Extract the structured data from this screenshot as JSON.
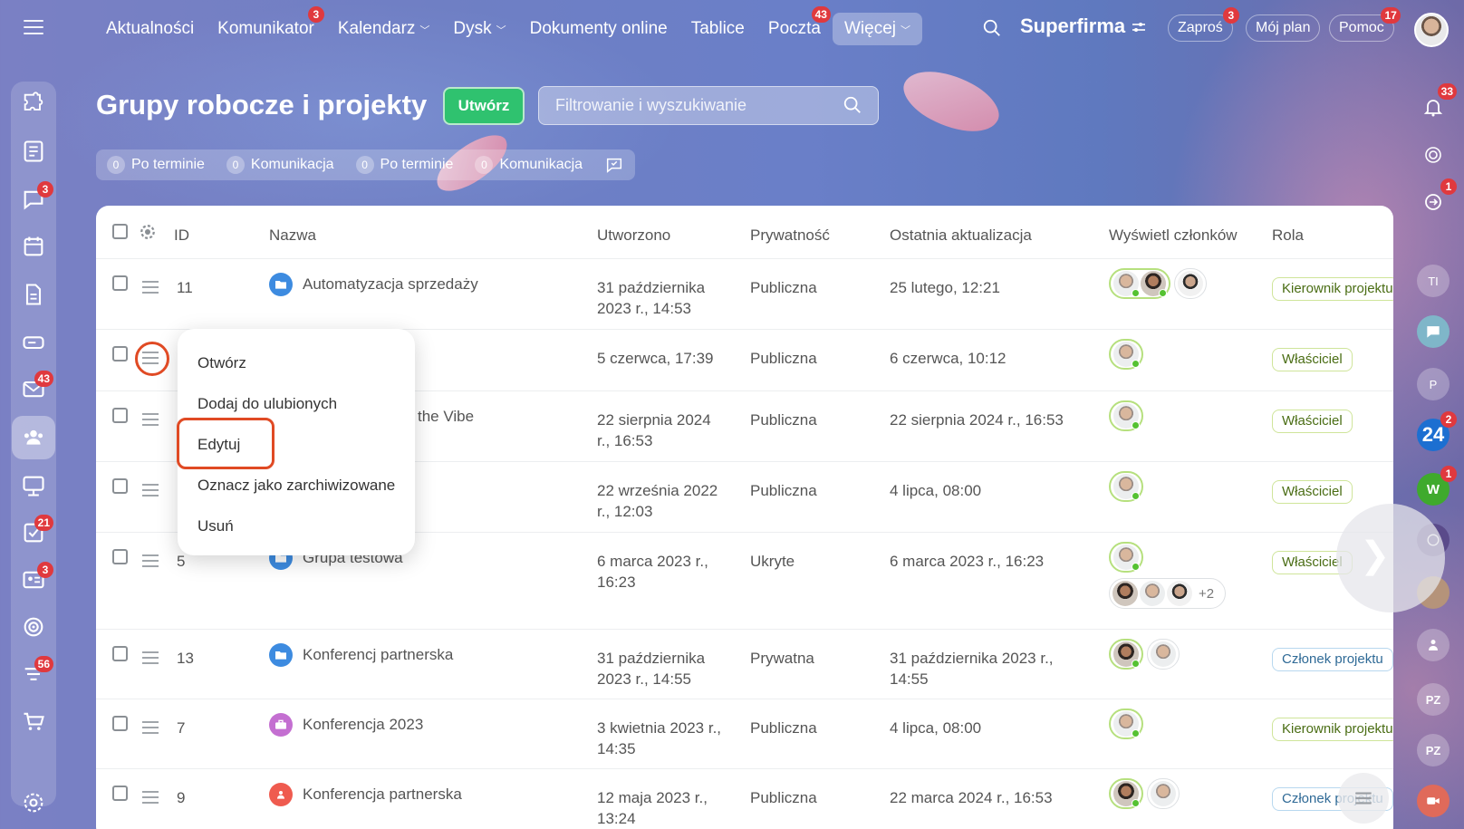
{
  "topnav": {
    "items": [
      {
        "label": "Aktualności"
      },
      {
        "label": "Komunikator",
        "badge": "3"
      },
      {
        "label": "Kalendarz",
        "chevron": true
      },
      {
        "label": "Dysk",
        "chevron": true
      },
      {
        "label": "Dokumenty online"
      },
      {
        "label": "Tablice"
      },
      {
        "label": "Poczta",
        "badge": "43"
      },
      {
        "label": "Więcej",
        "chevron": true,
        "active": true
      }
    ],
    "company": "Superfirma",
    "invite": {
      "label": "Zaproś",
      "badge": "3"
    },
    "plan": "Mój plan",
    "help": {
      "label": "Pomoc",
      "badge": "17"
    }
  },
  "left_sidebar": {
    "badges": {
      "chats": "3",
      "mail": "43",
      "tasks": "21",
      "crm": "3",
      "feed": "56"
    }
  },
  "right_sidebar": {
    "notifications_badge": "33",
    "sync_badge": "1",
    "b24": {
      "label": "24",
      "badge": "2"
    },
    "w": {
      "label": "W",
      "badge": "1"
    },
    "initials_1": "TI",
    "initials_2": "P",
    "initials_3": "PZ",
    "initials_4": "PZ"
  },
  "page": {
    "title": "Grupy robocze i projekty",
    "create_label": "Utwórz",
    "filter_placeholder": "Filtrowanie i wyszukiwanie",
    "counters": [
      {
        "count": "0",
        "label": "Po terminie"
      },
      {
        "count": "0",
        "label": "Komunikacja"
      },
      {
        "count": "0",
        "label": "Po terminie"
      },
      {
        "count": "0",
        "label": "Komunikacja"
      }
    ]
  },
  "table": {
    "headers": {
      "id": "ID",
      "name": "Nazwa",
      "created": "Utworzono",
      "privacy": "Prywatność",
      "updated": "Ostatnia aktualizacja",
      "members": "Wyświetl członków",
      "role": "Rola"
    },
    "rows": [
      {
        "id": "11",
        "name": "Automatyzacja sprzedaży",
        "created": "31 października 2023 r., 14:53",
        "privacy": "Publiczna",
        "updated": "25 lutego, 12:21",
        "role": "Kierownik projektu"
      },
      {
        "id": "",
        "name": "",
        "created": "5 czerwca, 17:39",
        "privacy": "Publiczna",
        "updated": "6 czerwca, 10:12",
        "role": "Właściciel"
      },
      {
        "id": "",
        "name": "the Vibe",
        "created": "22 sierpnia 2024 r., 16:53",
        "privacy": "Publiczna",
        "updated": "22 sierpnia 2024 r., 16:53",
        "role": "Właściciel"
      },
      {
        "id": "",
        "name": "",
        "created": "22 września 2022 r., 12:03",
        "privacy": "Publiczna",
        "updated": "4 lipca, 08:00",
        "role": "Właściciel"
      },
      {
        "id": "5",
        "name": "Grupa testowa",
        "created": "6 marca 2023 r., 16:23",
        "privacy": "Ukryte",
        "updated": "6 marca 2023 r., 16:23",
        "role": "Właściciel",
        "extra_members": "+2"
      },
      {
        "id": "13",
        "name": "Konferencj partnerska",
        "created": "31 października 2023 r., 14:55",
        "privacy": "Prywatna",
        "updated": "31 października 2023 r., 14:55",
        "role": "Członek projektu"
      },
      {
        "id": "7",
        "name": "Konferencja 2023",
        "created": "3 kwietnia 2023 r., 14:35",
        "privacy": "Publiczna",
        "updated": "4 lipca, 08:00",
        "role": "Kierownik projektu"
      },
      {
        "id": "9",
        "name": "Konferencja partnerska",
        "created": "12 maja 2023 r., 13:24",
        "privacy": "Publiczna",
        "updated": "22 marca 2024 r., 16:53",
        "role": "Członek projektu"
      }
    ]
  },
  "context_menu": {
    "items": [
      "Otwórz",
      "Dodaj do ulubionych",
      "Edytuj",
      "Oznacz jako zarchiwizowane",
      "Usuń"
    ]
  },
  "colors": {
    "accent_green": "#2fc26f",
    "badge_red": "#e0393e",
    "highlight": "#e04a24"
  }
}
